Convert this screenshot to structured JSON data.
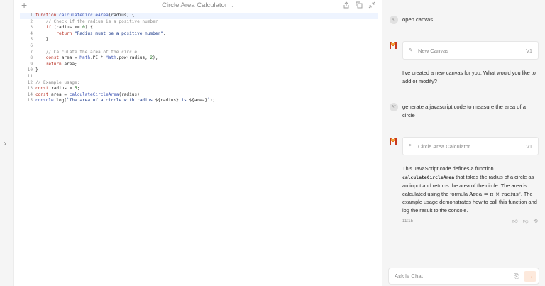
{
  "rail": {
    "expand_icon": "chevron-right-icon",
    "glyph": "›"
  },
  "canvas": {
    "new_glyph": "+",
    "title": "Circle Area Calculator",
    "title_chevron": "⌄",
    "toolbar_icons": [
      "share-icon",
      "copy-icon",
      "collapse-icon"
    ]
  },
  "code": {
    "lines": [
      {
        "n": "1",
        "text": "function calculateCircleArea(radius) {"
      },
      {
        "n": "2",
        "text": "    // Check if the radius is a positive number"
      },
      {
        "n": "3",
        "text": "    if (radius <= 0) {"
      },
      {
        "n": "4",
        "text": "        return \"Radius must be a positive number\";"
      },
      {
        "n": "5",
        "text": "    }"
      },
      {
        "n": "6",
        "text": ""
      },
      {
        "n": "7",
        "text": "    // Calculate the area of the circle"
      },
      {
        "n": "8",
        "text": "    const area = Math.PI * Math.pow(radius, 2);"
      },
      {
        "n": "9",
        "text": "    return area;"
      },
      {
        "n": "10",
        "text": "}"
      },
      {
        "n": "11",
        "text": ""
      },
      {
        "n": "12",
        "text": "// Example usage:"
      },
      {
        "n": "13",
        "text": "const radius = 5;"
      },
      {
        "n": "14",
        "text": "const area = calculateCircleArea(radius);"
      },
      {
        "n": "15",
        "text": "console.log(`The area of a circle with radius ${radius} is ${area}`);"
      }
    ]
  },
  "chat": {
    "user_badge": "AT",
    "messages": {
      "user1": "open canvas",
      "card1_title": "New Canvas",
      "card1_ver": "V1",
      "card1_icon": "pencil-icon",
      "bot1": "I've created a new canvas for you. What would you like to add or modify?",
      "user2": "generate a javascript code to measure the area of a circle",
      "card2_title": "Circle Area Calculator",
      "card2_ver": "V1",
      "card2_icon": "code-icon",
      "bot2_a": "This JavaScript code defines a function ",
      "bot2_code": "calculateCircleArea",
      "bot2_b": " that takes the radius of a circle as an input and returns the area of the circle. The area is calculated using the formula ",
      "bot2_formula": "Area = π × radius²",
      "bot2_c": ". The example usage demonstrates how to call this function and log the result to the console.",
      "time": "11:15"
    },
    "reaction_icons": [
      "thumbs-up-icon",
      "thumbs-down-icon",
      "retry-icon"
    ],
    "input": {
      "placeholder": "Ask le Chat",
      "attach_icon": "paperclip-icon",
      "send_icon": "send-arrow-icon"
    }
  },
  "colors": {
    "accent": "#f3a070",
    "logo_orange": "#e8731f",
    "logo_red": "#c8381e",
    "panel_bg": "#f5f5f5"
  }
}
